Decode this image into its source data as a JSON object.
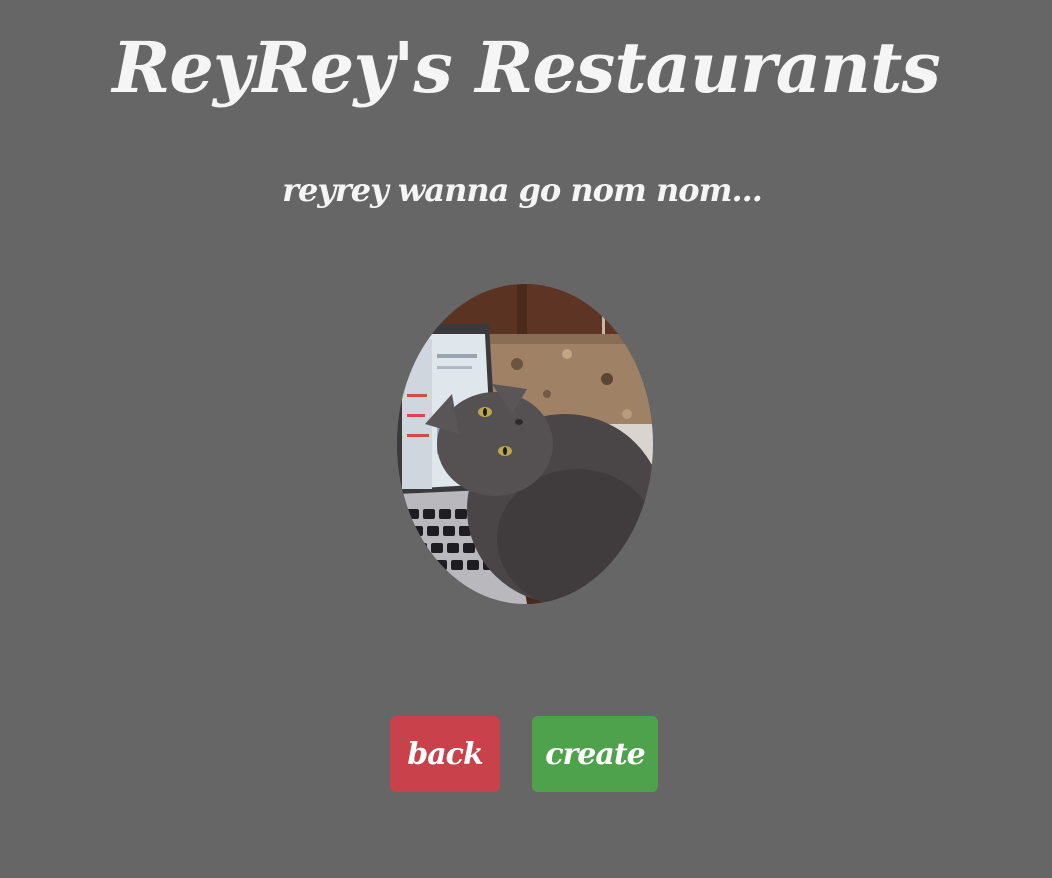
{
  "header": {
    "title": "ReyRey's Restaurants",
    "subtitle": "reyrey wanna go nom nom..."
  },
  "photo": {
    "subject": "cat-photo"
  },
  "actions": {
    "back_label": "back",
    "create_label": "create"
  },
  "colors": {
    "background": "#666666",
    "text": "#f5f5f5",
    "back_button": "#c9414b",
    "create_button": "#4ea24c"
  }
}
